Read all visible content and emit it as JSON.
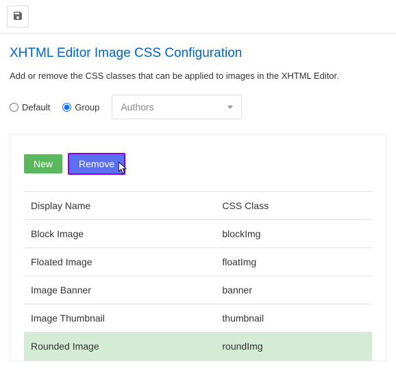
{
  "header": {
    "title": "XHTML Editor Image CSS Configuration",
    "description": "Add or remove the CSS classes that can be applied to images in the XHTML Editor."
  },
  "scope": {
    "default_label": "Default",
    "group_label": "Group",
    "selected": "group",
    "group_value": "Authors"
  },
  "buttons": {
    "new_label": "New",
    "remove_label": "Remove"
  },
  "table": {
    "col_display": "Display Name",
    "col_css": "CSS Class",
    "rows": [
      {
        "display": "Block Image",
        "css": "blockImg",
        "selected": false
      },
      {
        "display": "Floated Image",
        "css": "floatImg",
        "selected": false
      },
      {
        "display": "Image Banner",
        "css": "banner",
        "selected": false
      },
      {
        "display": "Image Thumbnail",
        "css": "thumbnail",
        "selected": false
      },
      {
        "display": "Rounded Image",
        "css": "roundImg",
        "selected": true
      }
    ]
  }
}
